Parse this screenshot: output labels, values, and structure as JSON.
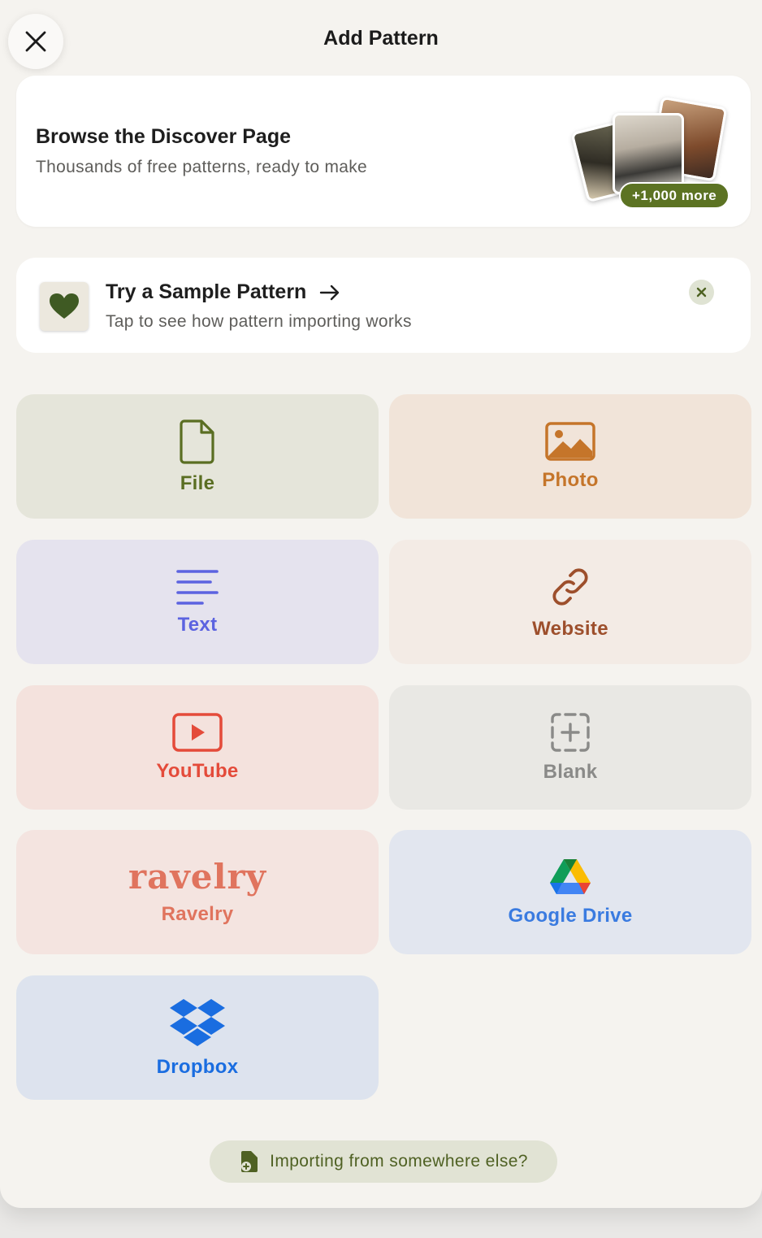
{
  "header": {
    "title": "Add Pattern"
  },
  "discover": {
    "title": "Browse the Discover Page",
    "subtitle": "Thousands of free patterns, ready to make",
    "badge": "+1,000 more"
  },
  "sample": {
    "title": "Try a Sample Pattern",
    "subtitle": "Tap to see how pattern importing works"
  },
  "sources": {
    "file": "File",
    "photo": "Photo",
    "text": "Text",
    "website": "Website",
    "youtube": "YouTube",
    "blank": "Blank",
    "ravelry_logo": "ravelry",
    "ravelry": "Ravelry",
    "google_drive": "Google Drive",
    "dropbox": "Dropbox"
  },
  "footer": {
    "label": "Importing from somewhere else?"
  },
  "colors": {
    "file": "#5a6e22",
    "photo": "#c5752a",
    "text": "#5c63e0",
    "website": "#9d4f2c",
    "youtube": "#e44b3a",
    "blank": "#8a8a88",
    "ravelry": "#e0745e",
    "google_drive": "#3a7be0",
    "dropbox": "#1a6de0"
  }
}
